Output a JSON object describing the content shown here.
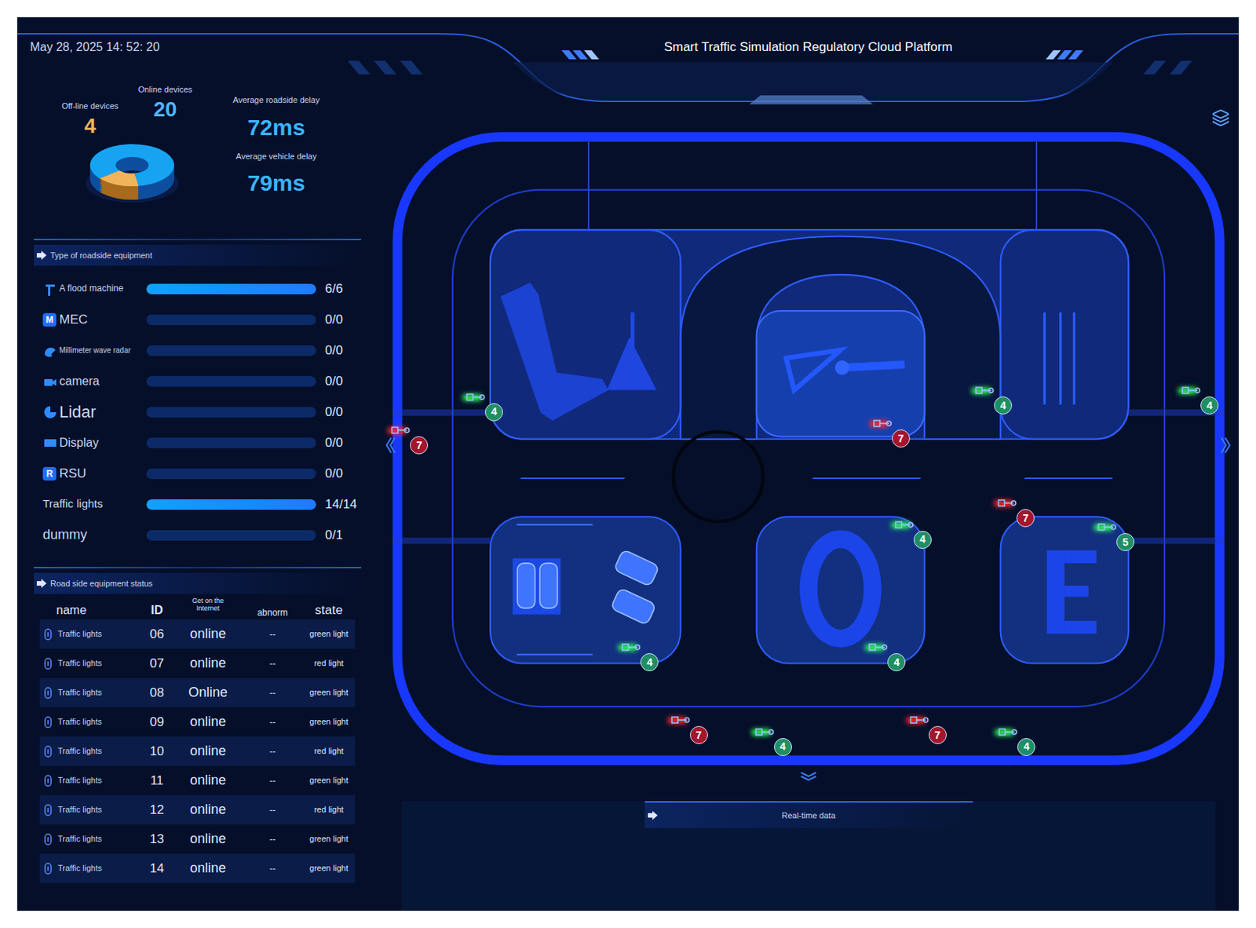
{
  "header": {
    "datetime": "May 28, 2025 14: 52: 20",
    "title": "Smart Traffic Simulation Regulatory Cloud Platform"
  },
  "summary": {
    "offline": {
      "label": "Off-line devices",
      "value": "4"
    },
    "online": {
      "label": "Online devices",
      "value": "20"
    },
    "roadside_delay": {
      "label": "Average roadside delay",
      "value": "72ms"
    },
    "vehicle_delay": {
      "label": "Average vehicle delay",
      "value": "79ms"
    }
  },
  "equipment": {
    "title": "Type of roadside equipment",
    "items": [
      {
        "label": "A flood machine",
        "kind": "icon",
        "count": "6/6",
        "level": 1
      },
      {
        "label": "MEC",
        "kind": "badge",
        "badge": "M",
        "count": "0/0",
        "level": 0
      },
      {
        "label": "Millimeter wave radar",
        "kind": "icon",
        "count": "0/0",
        "level": 0
      },
      {
        "label": "camera",
        "kind": "icon",
        "count": "0/0",
        "level": 0
      },
      {
        "label": "Lidar",
        "kind": "icon",
        "count": "0/0",
        "level": 0
      },
      {
        "label": "Display",
        "kind": "icon",
        "count": "0/0",
        "level": 0
      },
      {
        "label": "RSU",
        "kind": "badge",
        "badge": "R",
        "count": "0/0",
        "level": 0
      },
      {
        "label": "Traffic lights",
        "kind": "plain",
        "count": "14/14",
        "level": 1
      },
      {
        "label": "dummy",
        "kind": "plain",
        "count": "0/1",
        "level": 0
      }
    ]
  },
  "status": {
    "title": "Road side equipment status",
    "columns": [
      "name",
      "ID",
      "Get on the Internet",
      "abnorm",
      "state"
    ],
    "rows": [
      {
        "name": "Traffic lights",
        "id": "06",
        "internet": "online",
        "abnorm": "--",
        "state": "green light"
      },
      {
        "name": "Traffic lights",
        "id": "07",
        "internet": "online",
        "abnorm": "--",
        "state": "red light"
      },
      {
        "name": "Traffic lights",
        "id": "08",
        "internet": "Online",
        "abnorm": "--",
        "state": "green light"
      },
      {
        "name": "Traffic lights",
        "id": "09",
        "internet": "online",
        "abnorm": "--",
        "state": "green light"
      },
      {
        "name": "Traffic lights",
        "id": "10",
        "internet": "online",
        "abnorm": "--",
        "state": "red light"
      },
      {
        "name": "Traffic lights",
        "id": "11",
        "internet": "online",
        "abnorm": "--",
        "state": "green light"
      },
      {
        "name": "Traffic lights",
        "id": "12",
        "internet": "online",
        "abnorm": "--",
        "state": "red light"
      },
      {
        "name": "Traffic lights",
        "id": "13",
        "internet": "online",
        "abnorm": "--",
        "state": "green light"
      },
      {
        "name": "Traffic lights",
        "id": "14",
        "internet": "online",
        "abnorm": "--",
        "state": "green light"
      }
    ]
  },
  "map": {
    "lights": [
      {
        "label": "4",
        "signal": "green",
        "color": "#1f8f63"
      },
      {
        "label": "7",
        "signal": "red",
        "color": "#a3162c"
      },
      {
        "label": "7",
        "signal": "red",
        "color": "#a3162c"
      },
      {
        "label": "4",
        "signal": "green",
        "color": "#1f8f63"
      },
      {
        "label": "4",
        "signal": "green",
        "color": "#1f8f63"
      },
      {
        "label": "7",
        "signal": "red",
        "color": "#a3162c"
      },
      {
        "label": "4",
        "signal": "green",
        "color": "#1f8f63"
      },
      {
        "label": "5",
        "signal": "green",
        "color": "#1f8f63"
      },
      {
        "label": "4",
        "signal": "green",
        "color": "#1f8f63"
      },
      {
        "label": "4",
        "signal": "green",
        "color": "#1f8f63"
      },
      {
        "label": "7",
        "signal": "red",
        "color": "#a3162c"
      },
      {
        "label": "4",
        "signal": "green",
        "color": "#1f8f63"
      },
      {
        "label": "7",
        "signal": "red",
        "color": "#a3162c"
      },
      {
        "label": "4",
        "signal": "green",
        "color": "#1f8f63"
      }
    ]
  },
  "realtime": {
    "title": "Real-time data"
  }
}
